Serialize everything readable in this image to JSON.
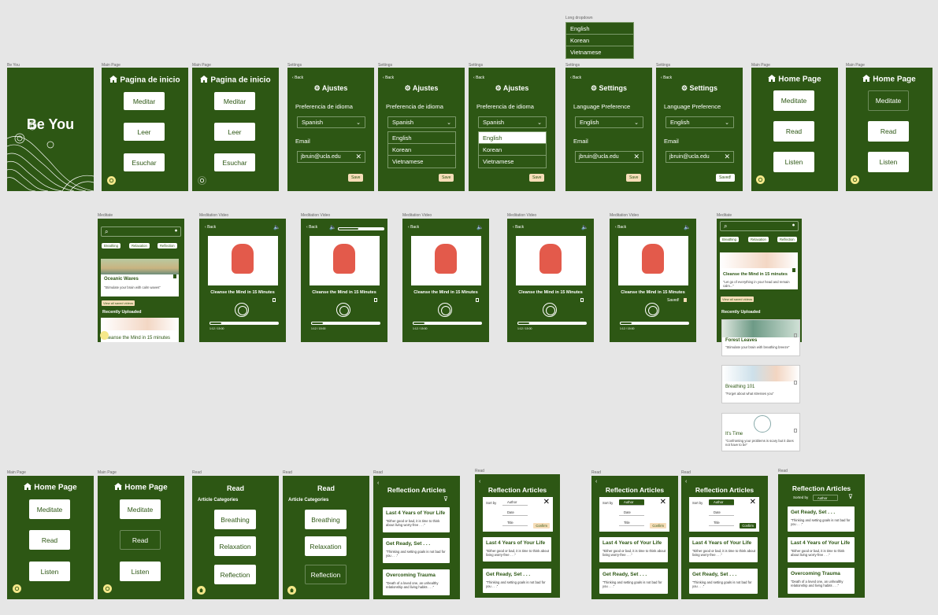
{
  "frames": {
    "be_you": "Be You",
    "main_page": "Main Page",
    "settings": "Settings",
    "long_dropdown": "Long dropdown",
    "meditate": "Meditate",
    "meditation_video": "Meditation Video",
    "read": "Read"
  },
  "splash": {
    "title": "Be You"
  },
  "spanish_home": {
    "title": "Pagina de inicio",
    "meditate": "Meditar",
    "read": "Leer",
    "listen": "Esuchar"
  },
  "english_home": {
    "title": "Home Page",
    "meditate": "Meditate",
    "read": "Read",
    "listen": "Listen"
  },
  "spanish_settings": {
    "title": "Ajustes",
    "language_label": "Preferencia de idioma",
    "language_value": "Spanish",
    "email_label": "Email",
    "email_value": "jbruin@ucla.edu",
    "save": "Save",
    "back": "Back"
  },
  "english_settings": {
    "title": "Settings",
    "language_label": "Language Preference",
    "language_value": "English",
    "email_label": "Email",
    "email_value": "jbruin@ucla.edu",
    "save": "Save",
    "saved": "Saved!",
    "back": "Back"
  },
  "languages": [
    "English",
    "Korean",
    "Vietnamese"
  ],
  "meditate": {
    "chips": [
      "Breathing",
      "Relaxation",
      "Reflection"
    ],
    "featured_title": "Oceanic Waves",
    "featured_sub": "\"Stimulate your brain with calm waves\"",
    "view_saved": "View all saved videos",
    "recently_uploaded": "Recently Uploaded",
    "recent_title": "Cleanse the Mind in 15 minutes",
    "alt_featured_title": "Cleanse the Mind in 15 minutes",
    "alt_featured_sub": "\"Let go of everything in your head and remain calm...\"",
    "list": [
      {
        "title": "Forest  Leaves",
        "sub": "\"Stimulate your brain with breathing breeze\""
      },
      {
        "title": "Breathing 101",
        "sub": "\"Forget about what stresses you\""
      },
      {
        "title": "It's Time",
        "sub": "\"Confronting your problems is scary but it does not have to be\""
      }
    ]
  },
  "video": {
    "title": "Cleanse the Mind in 15 Minutes",
    "time": "1:12 / 15:00",
    "saved": "Saved!",
    "back": "Back"
  },
  "read": {
    "title": "Read",
    "categories_label": "Article Categories",
    "categories": [
      "Breathing",
      "Relaxation",
      "Reflection"
    ],
    "reflection_title": "Reflection Articles",
    "sort_by": "Sort by",
    "sorted_by": "Sorted by",
    "sort_options": [
      "Author",
      "Date",
      "Title"
    ],
    "confirm": "Confirm",
    "articles": [
      {
        "title": "Last 4 Years of Your Life",
        "sub": "\"Either good or bad, it is time to think about living worry-free . . .\""
      },
      {
        "title": "Get Ready, Set . . .",
        "sub": "\"Thinking and setting goals is not bad for you . . .\""
      },
      {
        "title": "Overcoming Trauma",
        "sub": "\"Death of a loved one, an unhealthy relationship and living habits . . .\""
      }
    ]
  },
  "colors": {
    "brand_green": "#2d5714",
    "accent_yellow": "#f5e88a",
    "accent_peach": "#f6ddb8"
  }
}
